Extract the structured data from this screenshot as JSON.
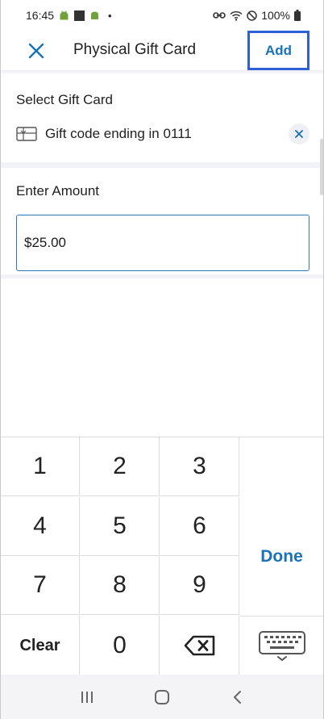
{
  "status_bar": {
    "time": "16:45",
    "dot": "•",
    "battery": "100%",
    "icons": [
      "android-icon",
      "square-icon",
      "android-icon",
      "link-icon",
      "wifi-icon",
      "do-not-disturb-icon",
      "battery-icon"
    ]
  },
  "app_bar": {
    "close_icon": "close-icon",
    "title": "Physical Gift Card",
    "add_label": "Add"
  },
  "gift_card": {
    "section_label": "Select Gift Card",
    "icon": "gift-card-icon",
    "text": "Gift code ending in 0111",
    "remove_icon": "close-icon"
  },
  "amount": {
    "section_label": "Enter Amount",
    "value": "$25.00"
  },
  "keypad": {
    "keys": [
      "1",
      "2",
      "3",
      "4",
      "5",
      "6",
      "7",
      "8",
      "9",
      "Clear",
      "0"
    ],
    "done_label": "Done",
    "backspace_icon": "backspace-icon",
    "keyboard_icon": "keyboard-hide-icon"
  },
  "nav_bar": {
    "icons": [
      "recent-apps-icon",
      "home-icon",
      "back-icon"
    ]
  },
  "colors": {
    "accent": "#1a73b8",
    "highlight_border": "#2f5fd6",
    "input_border": "#2d7ab8",
    "divider": "#f1f3f8"
  }
}
